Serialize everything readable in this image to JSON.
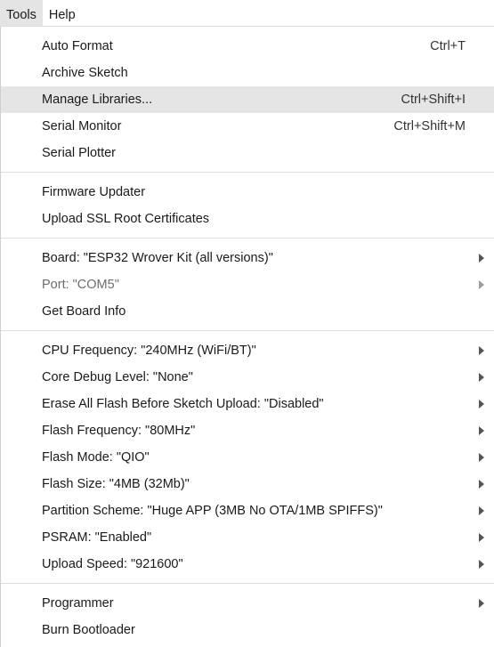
{
  "menubar": {
    "items": [
      {
        "label": "Tools",
        "active": true
      },
      {
        "label": "Help",
        "active": false
      }
    ]
  },
  "menu": {
    "groups": [
      [
        {
          "label": "Auto Format",
          "shortcut": "Ctrl+T"
        },
        {
          "label": "Archive Sketch",
          "shortcut": ""
        },
        {
          "label": "Manage Libraries...",
          "shortcut": "Ctrl+Shift+I",
          "highlighted": true
        },
        {
          "label": "Serial Monitor",
          "shortcut": "Ctrl+Shift+M"
        },
        {
          "label": "Serial Plotter",
          "shortcut": ""
        }
      ],
      [
        {
          "label": "Firmware Updater"
        },
        {
          "label": "Upload SSL Root Certificates"
        }
      ],
      [
        {
          "label": "Board: \"ESP32 Wrover Kit (all versions)\"",
          "submenu": true
        },
        {
          "label": "Port: \"COM5\"",
          "submenu": true,
          "disabled": true
        },
        {
          "label": "Get Board Info"
        }
      ],
      [
        {
          "label": "CPU Frequency: \"240MHz (WiFi/BT)\"",
          "submenu": true
        },
        {
          "label": "Core Debug Level: \"None\"",
          "submenu": true
        },
        {
          "label": "Erase All Flash Before Sketch Upload: \"Disabled\"",
          "submenu": true
        },
        {
          "label": "Flash Frequency: \"80MHz\"",
          "submenu": true
        },
        {
          "label": "Flash Mode: \"QIO\"",
          "submenu": true
        },
        {
          "label": "Flash Size: \"4MB (32Mb)\"",
          "submenu": true
        },
        {
          "label": "Partition Scheme: \"Huge APP (3MB No OTA/1MB SPIFFS)\"",
          "submenu": true
        },
        {
          "label": "PSRAM: \"Enabled\"",
          "submenu": true
        },
        {
          "label": "Upload Speed: \"921600\"",
          "submenu": true
        }
      ],
      [
        {
          "label": "Programmer",
          "submenu": true
        },
        {
          "label": "Burn Bootloader"
        }
      ]
    ]
  },
  "icons": {
    "submenu_arrow": "chevron-right-icon"
  },
  "colors": {
    "highlight": "#e5e5e5",
    "active_menubar": "#e4e4e4",
    "disabled_text": "#6d6d6d"
  }
}
